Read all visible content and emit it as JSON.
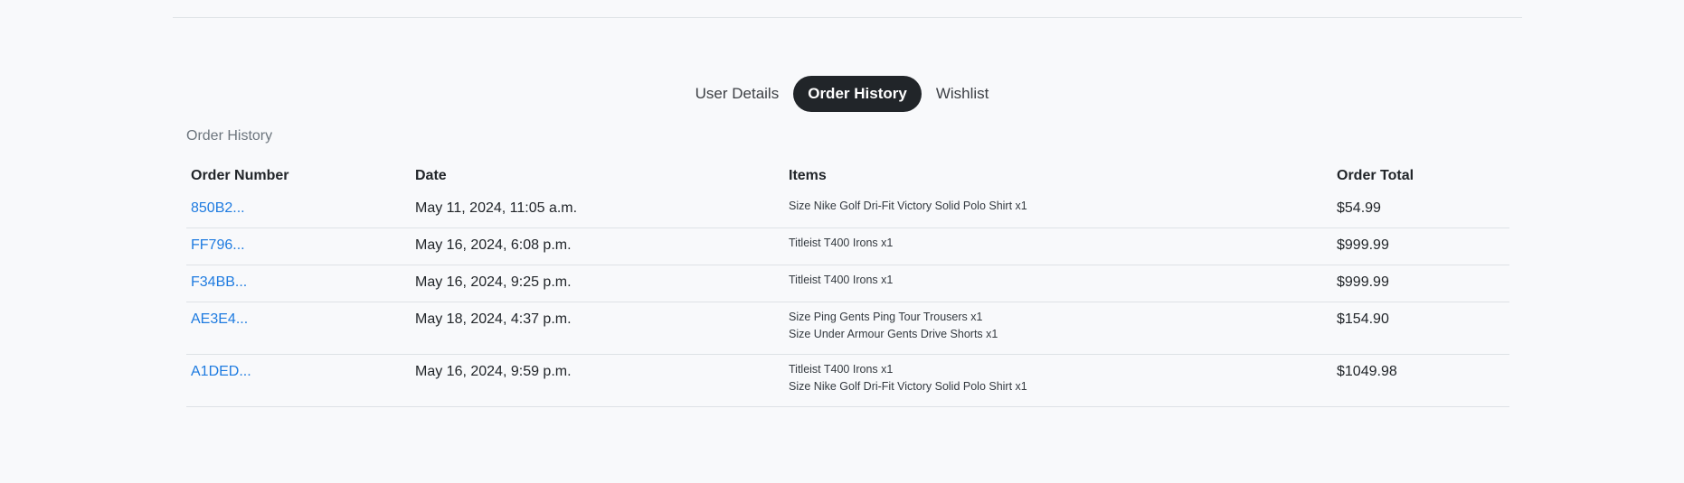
{
  "tabs": [
    {
      "label": "User Details",
      "active": false
    },
    {
      "label": "Order History",
      "active": true
    },
    {
      "label": "Wishlist",
      "active": false
    }
  ],
  "section_title": "Order History",
  "table": {
    "headers": [
      "Order Number",
      "Date",
      "Items",
      "Order Total"
    ],
    "rows": [
      {
        "order_number": "850B2...",
        "date": "May 11, 2024, 11:05 a.m.",
        "items": [
          "Size Nike Golf Dri-Fit Victory Solid Polo Shirt x1"
        ],
        "total": "$54.99"
      },
      {
        "order_number": "FF796...",
        "date": "May 16, 2024, 6:08 p.m.",
        "items": [
          "Titleist T400 Irons x1"
        ],
        "total": "$999.99"
      },
      {
        "order_number": "F34BB...",
        "date": "May 16, 2024, 9:25 p.m.",
        "items": [
          "Titleist T400 Irons x1"
        ],
        "total": "$999.99"
      },
      {
        "order_number": "AE3E4...",
        "date": "May 18, 2024, 4:37 p.m.",
        "items": [
          "Size Ping Gents Ping Tour Trousers x1",
          "Size Under Armour Gents Drive Shorts x1"
        ],
        "total": "$154.90"
      },
      {
        "order_number": "A1DED...",
        "date": "May 16, 2024, 9:59 p.m.",
        "items": [
          "Titleist T400 Irons x1",
          "Size Nike Golf Dri-Fit Victory Solid Polo Shirt x1"
        ],
        "total": "$1049.98"
      }
    ]
  },
  "colors": {
    "link": "#1e7be0",
    "active_tab_bg": "#212529",
    "background": "#f8f9fb"
  }
}
